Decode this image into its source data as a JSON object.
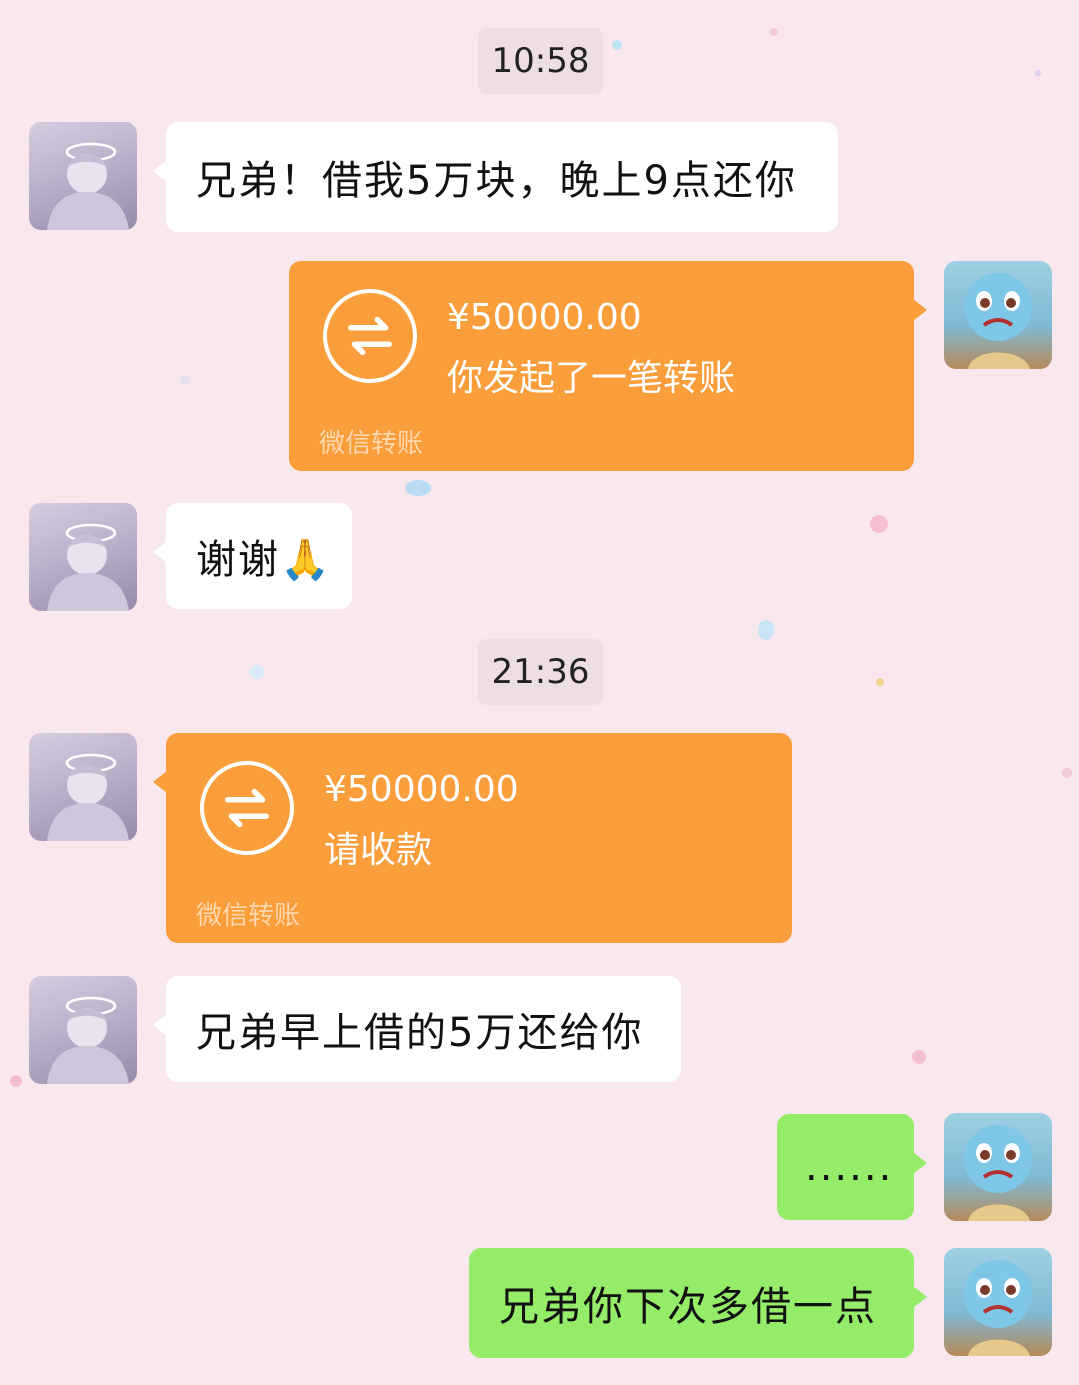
{
  "chat": {
    "timestamps": [
      "10:58",
      "21:36"
    ],
    "messages": [
      {
        "text": "兄弟！借我5万块，晚上9点还你"
      },
      {
        "amount": "¥50000.00",
        "description": "你发起了一笔转账",
        "footer": "微信转账"
      },
      {
        "text": "谢谢🙏"
      },
      {
        "amount": "¥50000.00",
        "description": "请收款",
        "footer": "微信转账"
      },
      {
        "text": "兄弟早上借的5万还给你"
      },
      {
        "text": "......"
      },
      {
        "text": "兄弟你下次多借一点"
      }
    ]
  },
  "colors": {
    "background": "#f9e7ee",
    "transfer_bubble": "#fa9d3b",
    "sent_bubble": "#95ec69",
    "received_bubble": "#ffffff"
  },
  "icons": {
    "transfer": "transfer-arrows-icon",
    "friend_avatar": "anime-girl-avatar",
    "my_avatar": "squirtle-avatar"
  }
}
